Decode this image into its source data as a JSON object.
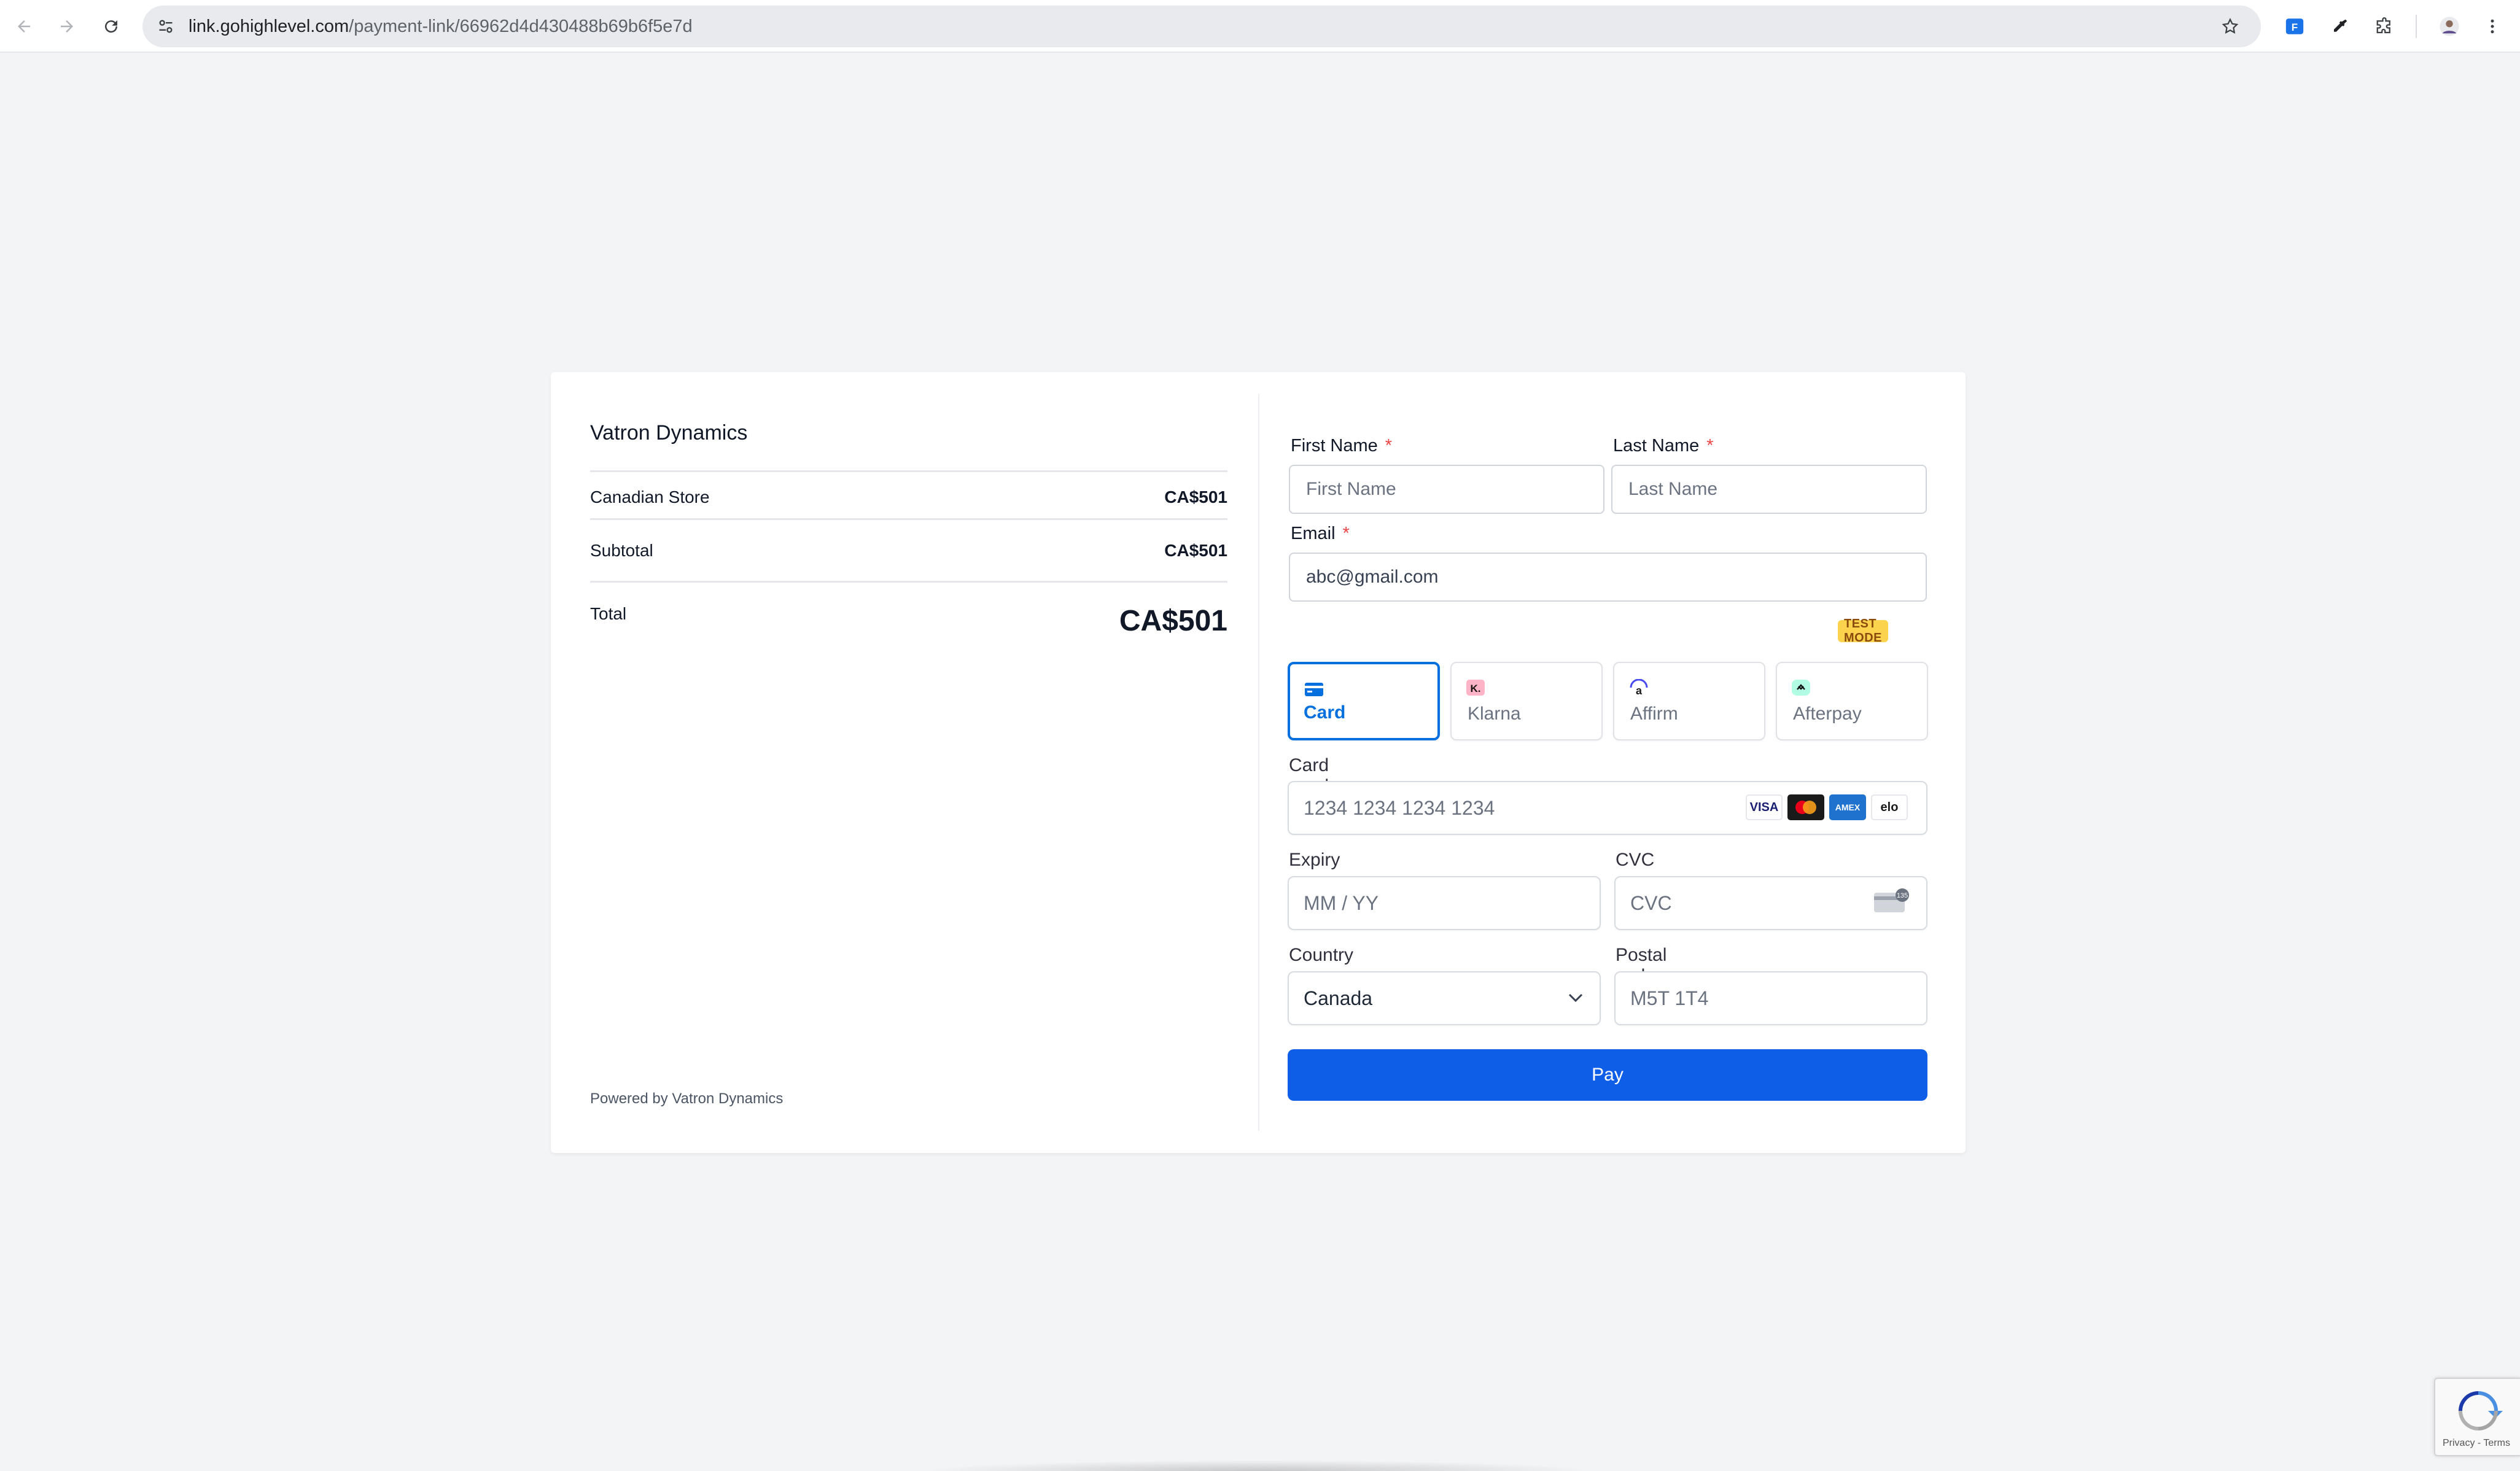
{
  "browser": {
    "url_host": "link.gohighlevel.com",
    "url_path": "/payment-link/66962d4d430488b69b6f5e7d"
  },
  "summary": {
    "vendor": "Vatron Dynamics",
    "items": [
      {
        "name": "Canadian Store",
        "amount": "CA$501"
      }
    ],
    "subtotal_label": "Subtotal",
    "subtotal_amount": "CA$501",
    "total_label": "Total",
    "total_amount": "CA$501",
    "powered_by": "Powered by Vatron Dynamics"
  },
  "form": {
    "first_name_label": "First Name",
    "first_name_placeholder": "First Name",
    "last_name_label": "Last Name",
    "last_name_placeholder": "Last Name",
    "required_mark": "*",
    "email_label": "Email",
    "email_value": "abc@gmail.com",
    "test_mode_badge": "TEST MODE",
    "payment_methods": [
      {
        "label": "Card",
        "icon": "card-icon",
        "selected": true
      },
      {
        "label": "Klarna",
        "icon": "klarna-icon",
        "selected": false
      },
      {
        "label": "Affirm",
        "icon": "affirm-icon",
        "selected": false
      },
      {
        "label": "Afterpay",
        "icon": "afterpay-icon",
        "selected": false
      }
    ],
    "card_number_label": "Card number",
    "card_number_placeholder": "1234 1234 1234 1234",
    "card_brands": [
      "VISA",
      "mastercard",
      "AMEX",
      "elo"
    ],
    "expiry_label": "Expiry",
    "expiry_placeholder": "MM / YY",
    "cvc_label": "CVC",
    "cvc_placeholder": "CVC",
    "country_label": "Country",
    "country_value": "Canada",
    "postal_label": "Postal code",
    "postal_placeholder": "M5T 1T4",
    "pay_label": "Pay"
  },
  "recaptcha": {
    "links": "Privacy - Terms"
  },
  "colors": {
    "page_bg": "#f3f4f6",
    "accent": "#0570de",
    "pay_button": "#0f5ee8",
    "required": "#ef4444",
    "badge_bg": "#fcd34d"
  }
}
